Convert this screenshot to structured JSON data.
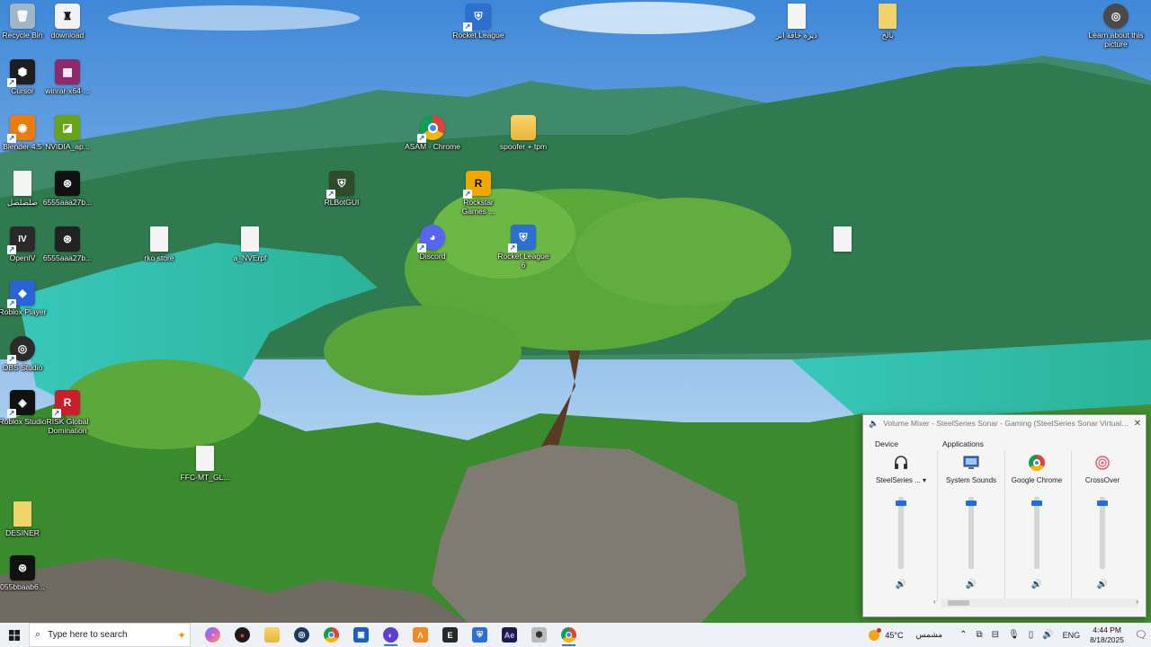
{
  "desktop": {
    "icons": [
      {
        "label": "Recycle Bin",
        "glyph": "🗑",
        "color": "#9fb6c8",
        "kind": "app"
      },
      {
        "label": "download",
        "glyph": "♜",
        "color": "#f2f2f2",
        "kind": "app"
      },
      {
        "label": "Cursor",
        "glyph": "⬢",
        "color": "#1e1e1e",
        "kind": "shortcut"
      },
      {
        "label": "winrar-x64-...",
        "glyph": "▦",
        "color": "#8c2a6b",
        "kind": "app"
      },
      {
        "label": "Blender 4.5",
        "glyph": "◉",
        "color": "#e87d0d",
        "kind": "shortcut"
      },
      {
        "label": "NVIDIA_ap...",
        "glyph": "◪",
        "color": "#66a41a",
        "kind": "app"
      },
      {
        "label": "صلصلصل",
        "glyph": "",
        "color": "#f2f2f2",
        "kind": "file"
      },
      {
        "label": "6555aaa27b...",
        "glyph": "⊛",
        "color": "#111",
        "kind": "app"
      },
      {
        "label": "OpenIV",
        "glyph": "IV",
        "color": "#2a2a2a",
        "kind": "shortcut"
      },
      {
        "label": "6555aaa27b...",
        "glyph": "⊛",
        "color": "#222",
        "kind": "app"
      },
      {
        "label": "rko store",
        "glyph": "",
        "color": "#f2f2f2",
        "kind": "file"
      },
      {
        "label": "a_NVErpf",
        "glyph": "",
        "color": "#f2f2f2",
        "kind": "file"
      },
      {
        "label": "Roblox Player",
        "glyph": "◆",
        "color": "#2a63d8",
        "kind": "shortcut"
      },
      {
        "label": "OBS Studio",
        "glyph": "◎",
        "color": "#2b2b2b",
        "kind": "shortcut"
      },
      {
        "label": "Roblox Studio",
        "glyph": "◈",
        "color": "#111",
        "kind": "shortcut"
      },
      {
        "label": "RISK Global Domination",
        "glyph": "R",
        "color": "#c8202a",
        "kind": "shortcut"
      },
      {
        "label": "FFC-MT_GL...",
        "glyph": "",
        "color": "#f2f2f2",
        "kind": "file"
      },
      {
        "label": "DESINER",
        "glyph": "",
        "color": "#f2f2f2",
        "kind": "file"
      },
      {
        "label": "055bbaab6...",
        "glyph": "⊛",
        "color": "#111",
        "kind": "app"
      },
      {
        "label": "Rocket League",
        "glyph": "⛨",
        "color": "#2c6fcf",
        "kind": "shortcut"
      },
      {
        "label": "ASAM - Chrome",
        "glyph": "◐",
        "color": "#e8e8e8",
        "kind": "shortcut"
      },
      {
        "label": "spoofer + tpm",
        "glyph": "",
        "color": "#f2d36a",
        "kind": "folder"
      },
      {
        "label": "RLBotGUI",
        "glyph": "⛨",
        "color": "#2f4c2a",
        "kind": "shortcut"
      },
      {
        "label": "Rockstar Games ...",
        "glyph": "R",
        "color": "#f0a800",
        "kind": "shortcut"
      },
      {
        "label": "Discord",
        "glyph": "◕",
        "color": "#5865f2",
        "kind": "shortcut"
      },
      {
        "label": "Rocket League 6",
        "glyph": "⛨",
        "color": "#2c6fcf",
        "kind": "shortcut"
      },
      {
        "label": "ذيرة خافة ابر",
        "glyph": "",
        "color": "#f2f2f2",
        "kind": "file"
      },
      {
        "label": "بالخ",
        "glyph": "",
        "color": "#f2d36a",
        "kind": "file"
      },
      {
        "label": "Learn about this picture",
        "glyph": "◎",
        "color": "#4a4a4a",
        "kind": "app"
      },
      {
        "label": "",
        "glyph": "",
        "color": "#f2f2f2",
        "kind": "file"
      }
    ]
  },
  "mixer": {
    "title": "Volume Mixer - SteelSeries Sonar - Gaming (SteelSeries Sonar Virtual Audio ...",
    "device_header": "Device",
    "apps_header": "Applications",
    "channels": [
      {
        "name": "SteelSeries ...",
        "icon": "headset-icon",
        "level": 0.95
      },
      {
        "name": "System Sounds",
        "icon": "system-sounds-icon",
        "level": 0.95
      },
      {
        "name": "Google Chrome",
        "icon": "chrome-icon",
        "level": 0.95
      },
      {
        "name": "CrossOver",
        "icon": "crossover-icon",
        "level": 0.95
      }
    ]
  },
  "taskbar": {
    "search_placeholder": "Type here to search",
    "apps": [
      "copilot",
      "app-red-dot",
      "file-explorer",
      "steam",
      "chrome",
      "store",
      "chrome-dev",
      "sublime",
      "epic-games",
      "rocket-league",
      "after-effects",
      "cursor",
      "chrome-2"
    ],
    "weather_temp": "45°C",
    "weather_desc": "مشمس",
    "language": "ENG",
    "time": "4:44 PM",
    "date": "8/18/2025"
  }
}
